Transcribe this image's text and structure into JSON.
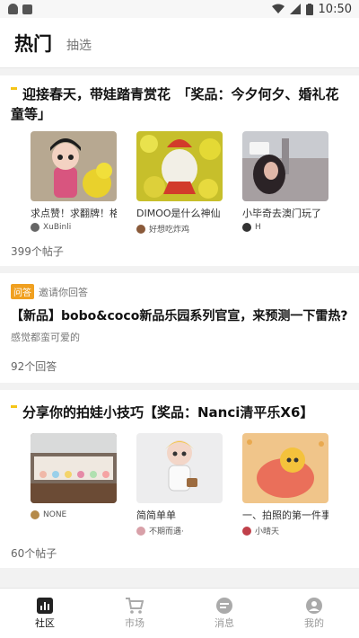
{
  "status_bar": {
    "time": "10:50"
  },
  "header": {
    "tab_active": "热门",
    "tab_other": "抽选"
  },
  "topics": [
    {
      "title": "迎接春天，带娃踏青赏花　「奖品：今夕何夕、婚礼花童等」",
      "items": [
        {
          "caption": "求点赞！求翻牌！格",
          "user": "XuBinli"
        },
        {
          "caption": "DIMOO是什么神仙",
          "user": "好想吃炸鸡"
        },
        {
          "caption": "小毕奇去澳门玩了",
          "user": "H"
        }
      ],
      "count": "399个帖子"
    },
    {
      "title": "分享你的拍娃小技巧【奖品：Nanci清平乐X6】",
      "items": [
        {
          "caption": "",
          "user": "NONE"
        },
        {
          "caption": "简简单单",
          "user": "不期而遇·"
        },
        {
          "caption": "一、拍照的第一件事",
          "user": "小晴天"
        }
      ],
      "count": "60个帖子"
    }
  ],
  "question": {
    "badge": "问答",
    "invite": "邀请你回答",
    "title": "【新品】bobo&coco新品乐园系列官宣，来预测一下雷热?",
    "subtitle": "感觉都蛮可爱的",
    "answers": "92个回答"
  },
  "bottom_nav": [
    {
      "label": "社区",
      "icon": "community-chart-icon",
      "active": true
    },
    {
      "label": "市场",
      "icon": "cart-icon",
      "active": false
    },
    {
      "label": "消息",
      "icon": "message-icon",
      "active": false
    },
    {
      "label": "我的",
      "icon": "profile-icon",
      "active": false
    }
  ],
  "colors": {
    "accent": "#f5c518",
    "badge": "#f0a020"
  }
}
